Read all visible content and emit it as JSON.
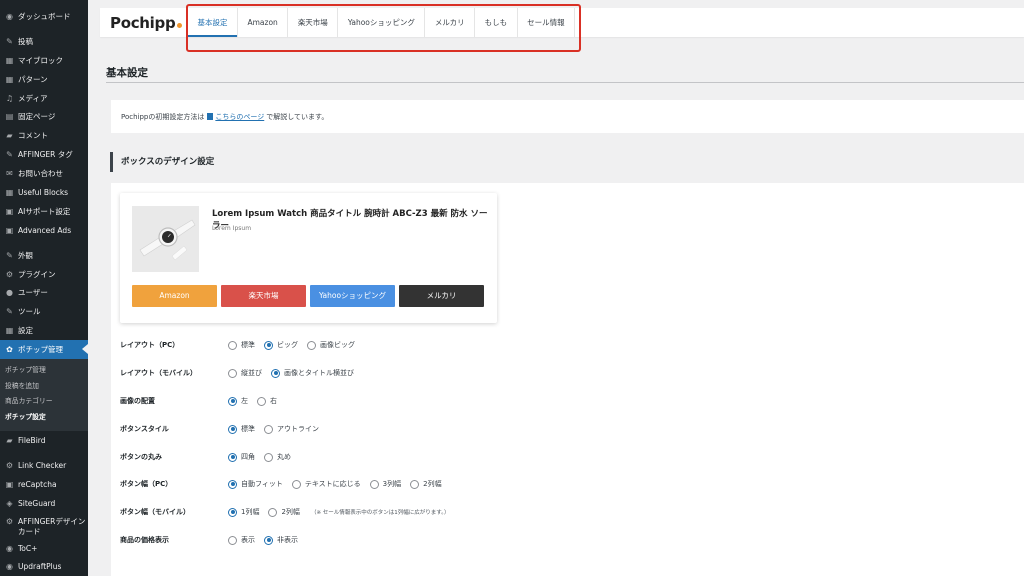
{
  "sidebar": {
    "items": [
      {
        "label": "ダッシュボード",
        "icon": "◉"
      },
      {
        "label": "投稿",
        "icon": "✎"
      },
      {
        "label": "マイブロック",
        "icon": "▦"
      },
      {
        "label": "パターン",
        "icon": "▦"
      },
      {
        "label": "メディア",
        "icon": "♫"
      },
      {
        "label": "固定ページ",
        "icon": "▤"
      },
      {
        "label": "コメント",
        "icon": "▰"
      },
      {
        "label": "AFFINGER タグ",
        "icon": "✎"
      },
      {
        "label": "お問い合わせ",
        "icon": "✉"
      },
      {
        "label": "Useful Blocks",
        "icon": "▦"
      },
      {
        "label": "AIサポート設定",
        "icon": "▣"
      },
      {
        "label": "Advanced Ads",
        "icon": "▣"
      },
      {
        "label": "外観",
        "icon": "✎"
      },
      {
        "label": "プラグイン",
        "icon": "⚙"
      },
      {
        "label": "ユーザー",
        "icon": "●"
      },
      {
        "label": "ツール",
        "icon": "✎"
      },
      {
        "label": "設定",
        "icon": "▦"
      },
      {
        "label": "ポチップ管理",
        "icon": "✿"
      }
    ],
    "submenu": [
      "ポチップ管理",
      "投稿を追加",
      "商品カテゴリー",
      "ポチップ設定"
    ],
    "items_after": [
      {
        "label": "FileBird",
        "icon": "▰"
      },
      {
        "label": "Link Checker",
        "icon": "⚙"
      },
      {
        "label": "reCaptcha",
        "icon": "▣"
      },
      {
        "label": "SiteGuard",
        "icon": "◈"
      },
      {
        "label": "AFFINGERデザインカード",
        "icon": "⚙"
      },
      {
        "label": "ToC+",
        "icon": "◉"
      },
      {
        "label": "UpdraftPlus",
        "icon": "◉"
      }
    ]
  },
  "header": {
    "logo": "Pochipp",
    "tabs": [
      "基本設定",
      "Amazon",
      "楽天市場",
      "Yahooショッピング",
      "メルカリ",
      "もしも",
      "セール情報"
    ],
    "active_tab": 0,
    "highlight_color": "#d93025"
  },
  "page": {
    "title": "基本設定",
    "info_prefix": "Pochippの初期設定方法は",
    "info_link": "こちらのページ",
    "info_suffix": "で解説しています。",
    "section_title": "ボックスのデザイン設定"
  },
  "preview": {
    "title": "Lorem Ipsum Watch 商品タイトル 腕時計 ABC-Z3 最新 防水 ソーラー",
    "subtitle": "Lorem Ipsum",
    "buttons": [
      {
        "label": "Amazon",
        "color": "#f0a23d"
      },
      {
        "label": "楽天市場",
        "color": "#d9514a"
      },
      {
        "label": "Yahooショッピング",
        "color": "#4a90e2"
      },
      {
        "label": "メルカリ",
        "color": "#333333"
      }
    ]
  },
  "settings": [
    {
      "label": "レイアウト（PC）",
      "options": [
        "標準",
        "ビッグ",
        "画像ビッグ"
      ],
      "selected": 1
    },
    {
      "label": "レイアウト（モバイル）",
      "options": [
        "縦並び",
        "画像とタイトル横並び"
      ],
      "selected": 1
    },
    {
      "label": "画像の配置",
      "options": [
        "左",
        "右"
      ],
      "selected": 0
    },
    {
      "label": "ボタンスタイル",
      "options": [
        "標準",
        "アウトライン"
      ],
      "selected": 0
    },
    {
      "label": "ボタンの丸み",
      "options": [
        "四角",
        "丸め"
      ],
      "selected": 0
    },
    {
      "label": "ボタン幅（PC）",
      "options": [
        "自動フィット",
        "テキストに応じる",
        "3列幅",
        "2列幅"
      ],
      "selected": 0
    },
    {
      "label": "ボタン幅（モバイル）",
      "options": [
        "1列幅",
        "2列幅"
      ],
      "selected": 0,
      "note": "（※ セール情報表示中のボタンは1列幅に広がります。）"
    },
    {
      "label": "商品の価格表示",
      "options": [
        "表示",
        "非表示"
      ],
      "selected": 1
    }
  ]
}
